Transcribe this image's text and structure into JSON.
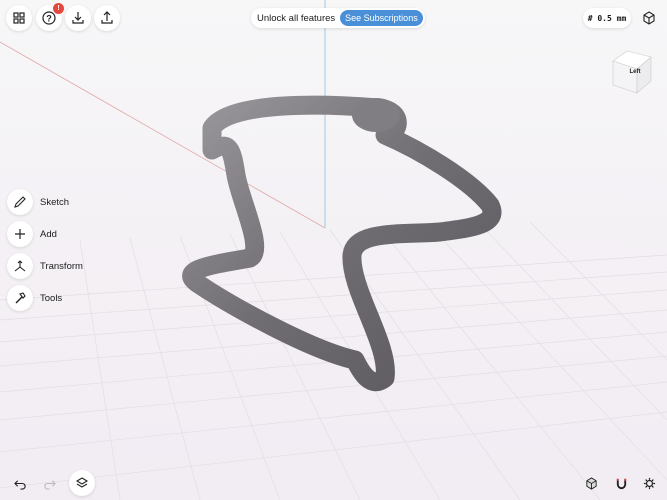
{
  "header": {
    "promo_text": "Unlock all features",
    "subscriptions_label": "See Subscriptions",
    "help_badge": "!",
    "grid_size": "# 0.5 mm"
  },
  "view_cube": {
    "face_label": "Left"
  },
  "tools": [
    {
      "label": "Sketch",
      "icon": "pencil-icon"
    },
    {
      "label": "Add",
      "icon": "plus-icon"
    },
    {
      "label": "Transform",
      "icon": "transform-icon"
    },
    {
      "label": "Tools",
      "icon": "hammer-icon"
    }
  ],
  "colors": {
    "accent": "#4a90d9",
    "badge": "#e8453c",
    "model": "#7d7a80"
  }
}
